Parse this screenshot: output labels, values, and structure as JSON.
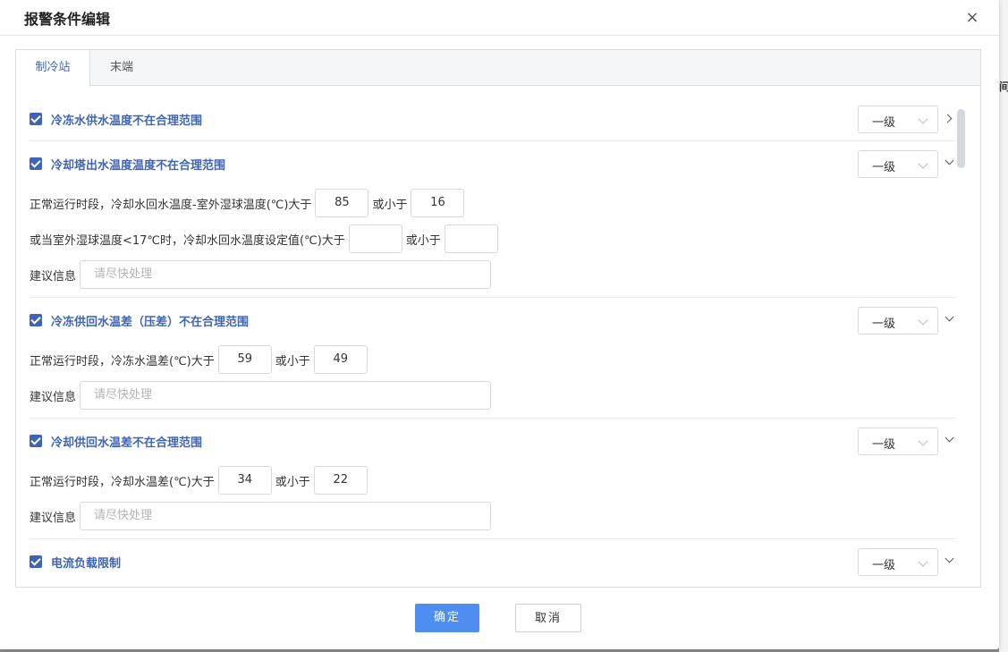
{
  "dialog": {
    "title": "报警条件编辑",
    "close_label": "×"
  },
  "tabs": [
    {
      "label": "制冷站",
      "active": true
    },
    {
      "label": "末端",
      "active": false
    }
  ],
  "items": [
    {
      "title": "冷冻水供水温度不在合理范围",
      "checked": true,
      "level": "一级",
      "expanded": false
    },
    {
      "title": "冷却塔出水温度温度不在合理范围",
      "checked": true,
      "level": "一级",
      "expanded": true,
      "row1": {
        "label": "正常运行时段，冷却水回水温度-室外湿球温度(℃)大于",
        "value": "85",
        "or_label": "或小于",
        "value2": "16"
      },
      "row2": {
        "label": "或当室外湿球温度<17℃时，冷却水回水温度设定值(℃)大于",
        "value": "",
        "or_label": "或小于",
        "value2": ""
      },
      "advice": {
        "label": "建议信息",
        "placeholder": "请尽快处理"
      }
    },
    {
      "title": "冷冻供回水温差（压差）不在合理范围",
      "checked": true,
      "level": "一级",
      "expanded": true,
      "row1": {
        "label": "正常运行时段，冷冻水温差(℃)大于",
        "value": "59",
        "or_label": "或小于",
        "value2": "49"
      },
      "advice": {
        "label": "建议信息",
        "placeholder": "请尽快处理"
      }
    },
    {
      "title": "冷却供回水温差不在合理范围",
      "checked": true,
      "level": "一级",
      "expanded": true,
      "row1": {
        "label": "正常运行时段，冷却水温差(℃)大于",
        "value": "34",
        "or_label": "或小于",
        "value2": "22"
      },
      "advice": {
        "label": "建议信息",
        "placeholder": "请尽快处理"
      }
    },
    {
      "title": "电流负载限制",
      "checked": true,
      "level": "一级",
      "expanded": true
    }
  ],
  "footer": {
    "ok_label": "确定",
    "cancel_label": "取消"
  },
  "colors": {
    "accent": "#3e64b3",
    "primary_button": "#4e8ef0"
  }
}
